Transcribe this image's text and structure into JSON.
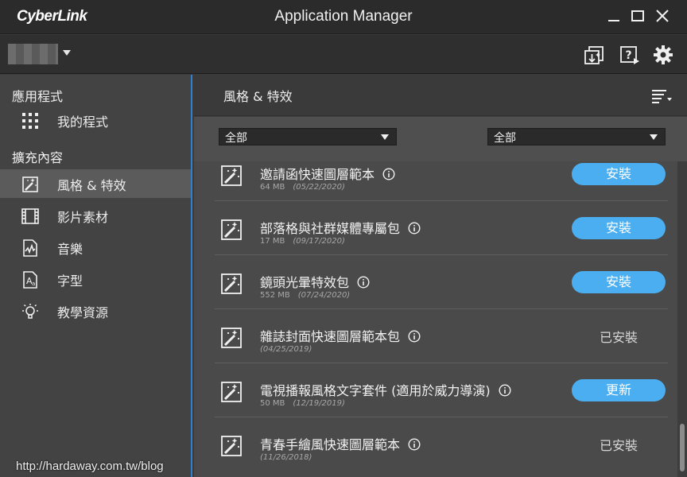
{
  "titlebar": {
    "logo": "CyberLink",
    "title": "Application Manager"
  },
  "toolbar": {
    "icons": [
      "update-icon",
      "help-icon",
      "gear-icon"
    ]
  },
  "sidebar": {
    "apps_title": "應用程式",
    "my_programs": "我的程式",
    "ext_title": "擴充內容",
    "items": [
      {
        "label": "風格 & 特效",
        "icon": "magic-wand-icon"
      },
      {
        "label": "影片素材",
        "icon": "film-icon"
      },
      {
        "label": "音樂",
        "icon": "music-icon"
      },
      {
        "label": "字型",
        "icon": "font-icon"
      },
      {
        "label": "教學資源",
        "icon": "lightbulb-icon"
      }
    ]
  },
  "main": {
    "title": "風格 & 特效",
    "filter1": "全部",
    "filter2": "全部",
    "items": [
      {
        "title": "邀請函快速圖層範本",
        "size": "64 MB",
        "date": "(05/22/2020)",
        "action": "安裝",
        "status": "install"
      },
      {
        "title": "部落格與社群媒體專屬包",
        "size": "17 MB",
        "date": "(09/17/2020)",
        "action": "安裝",
        "status": "install"
      },
      {
        "title": "鏡頭光暈特效包",
        "size": "552 MB",
        "date": "(07/24/2020)",
        "action": "安裝",
        "status": "install"
      },
      {
        "title": "雜誌封面快速圖層範本包",
        "size": "",
        "date": "(04/25/2019)",
        "action": "已安裝",
        "status": "installed"
      },
      {
        "title": "電視播報風格文字套件 (適用於威力導演)",
        "size": "50 MB",
        "date": "(12/19/2019)",
        "action": "更新",
        "status": "update"
      },
      {
        "title": "青春手繪風快速圖層範本",
        "size": "",
        "date": "(11/26/2018)",
        "action": "已安裝",
        "status": "installed"
      }
    ]
  },
  "watermark": "http://hardaway.com.tw/blog",
  "colors": {
    "accent": "#4aaef0",
    "sidebar_border": "#2e7fcf"
  }
}
